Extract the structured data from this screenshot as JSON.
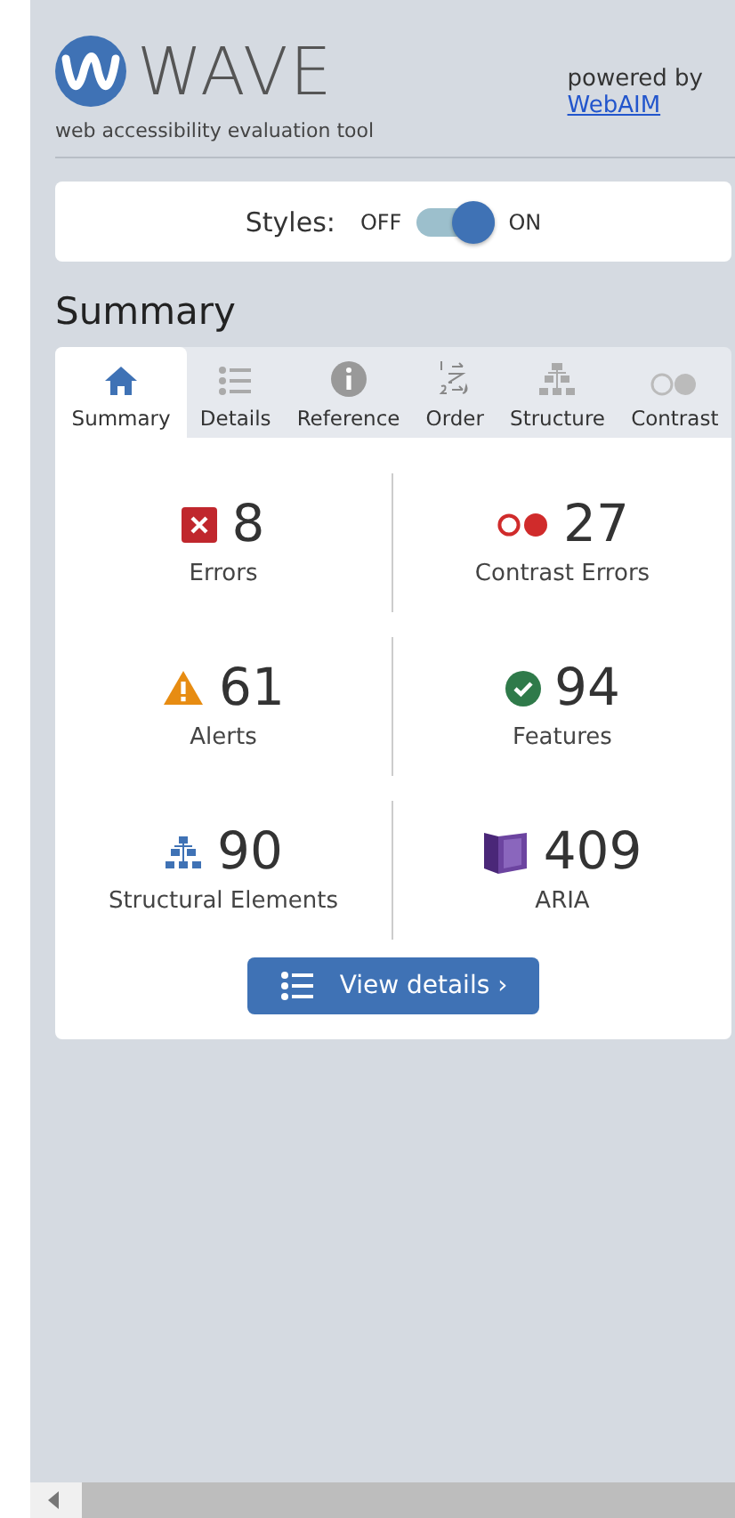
{
  "logo": {
    "title": "WAVE",
    "tagline": "web accessibility evaluation tool"
  },
  "powered": {
    "text": "powered by",
    "link": "WebAIM"
  },
  "styles": {
    "label": "Styles:",
    "off": "OFF",
    "on_label": "ON",
    "on": true
  },
  "heading": "Summary",
  "tabs": [
    {
      "kind": "home",
      "label": "Summary",
      "selected": true
    },
    {
      "kind": "list",
      "label": "Details",
      "selected": false
    },
    {
      "kind": "info",
      "label": "Reference",
      "selected": false
    },
    {
      "kind": "order",
      "label": "Order",
      "selected": false
    },
    {
      "kind": "tree",
      "label": "Structure",
      "selected": false
    },
    {
      "kind": "contrast",
      "label": "Contrast",
      "selected": false
    }
  ],
  "stats": [
    {
      "kind": "error",
      "count": "8",
      "label": "Errors"
    },
    {
      "kind": "contrast",
      "count": "27",
      "label": "Contrast Errors"
    },
    {
      "kind": "alert",
      "count": "61",
      "label": "Alerts"
    },
    {
      "kind": "feature",
      "count": "94",
      "label": "Features"
    },
    {
      "kind": "structure",
      "count": "90",
      "label": "Structural Elements"
    },
    {
      "kind": "aria",
      "count": "409",
      "label": "ARIA"
    }
  ],
  "button": "View details ›"
}
